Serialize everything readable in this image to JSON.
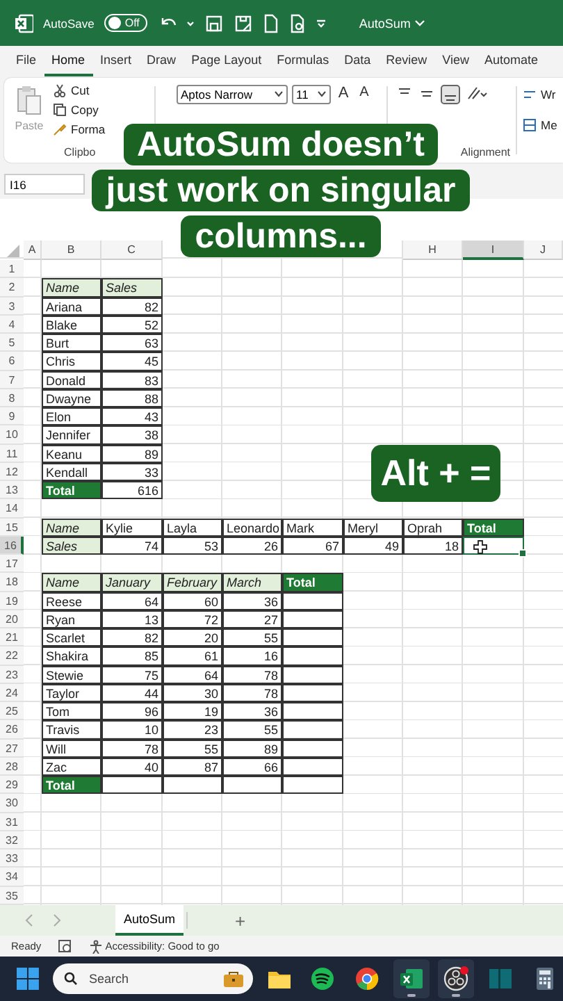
{
  "title_bar": {
    "autosave_label": "AutoSave",
    "autosave": {
      "on": false,
      "label": "Off"
    },
    "document": "AutoSum"
  },
  "menu_tabs": [
    {
      "label": "File",
      "selected": false
    },
    {
      "label": "Home",
      "selected": true
    },
    {
      "label": "Insert",
      "selected": false
    },
    {
      "label": "Draw",
      "selected": false
    },
    {
      "label": "Page Layout",
      "selected": false
    },
    {
      "label": "Formulas",
      "selected": false
    },
    {
      "label": "Data",
      "selected": false
    },
    {
      "label": "Review",
      "selected": false
    },
    {
      "label": "View",
      "selected": false
    },
    {
      "label": "Automate",
      "selected": false
    }
  ],
  "ribbon": {
    "paste": "Paste",
    "cut": "Cut",
    "copy": "Copy",
    "format_painter": "Forma",
    "clipboard_label": "Clipbo",
    "font": "Aptos Narrow",
    "font_size": "11",
    "grow_font": "A",
    "shrink_font": "A",
    "alignment_label": "Alignment",
    "wrap_text": "Wr",
    "merge": "Me"
  },
  "name_box": "I16",
  "caption": {
    "lines": [
      "AutoSum doesn’t",
      "just work on singular",
      "columns..."
    ]
  },
  "shortcut_caption": "Alt + =",
  "sheet": {
    "columns": [
      {
        "label": "A",
        "selected": false
      },
      {
        "label": "B",
        "selected": false
      },
      {
        "label": "C",
        "selected": false
      },
      {
        "label": "H",
        "selected": false
      },
      {
        "label": "I",
        "selected": true
      },
      {
        "label": "J",
        "selected": false
      }
    ],
    "rows": [
      {
        "label": "1",
        "selected": false
      },
      {
        "label": "2",
        "selected": false
      },
      {
        "label": "3",
        "selected": false
      },
      {
        "label": "4",
        "selected": false
      },
      {
        "label": "5",
        "selected": false
      },
      {
        "label": "6",
        "selected": false
      },
      {
        "label": "7",
        "selected": false
      },
      {
        "label": "8",
        "selected": false
      },
      {
        "label": "9",
        "selected": false
      },
      {
        "label": "10",
        "selected": false
      },
      {
        "label": "11",
        "selected": false
      },
      {
        "label": "12",
        "selected": false
      },
      {
        "label": "13",
        "selected": false
      },
      {
        "label": "14",
        "selected": false
      },
      {
        "label": "15",
        "selected": false
      },
      {
        "label": "16",
        "selected": true
      },
      {
        "label": "17",
        "selected": false
      },
      {
        "label": "18",
        "selected": false
      },
      {
        "label": "19",
        "selected": false
      },
      {
        "label": "20",
        "selected": false
      },
      {
        "label": "21",
        "selected": false
      },
      {
        "label": "22",
        "selected": false
      },
      {
        "label": "23",
        "selected": false
      },
      {
        "label": "24",
        "selected": false
      },
      {
        "label": "25",
        "selected": false
      },
      {
        "label": "26",
        "selected": false
      },
      {
        "label": "27",
        "selected": false
      },
      {
        "label": "28",
        "selected": false
      },
      {
        "label": "29",
        "selected": false
      },
      {
        "label": "30",
        "selected": false
      },
      {
        "label": "31",
        "selected": false
      },
      {
        "label": "32",
        "selected": false
      },
      {
        "label": "33",
        "selected": false
      },
      {
        "label": "34",
        "selected": false
      },
      {
        "label": "35",
        "selected": false
      }
    ],
    "tables": [
      {
        "rows": [
          [
            {
              "kind": "header",
              "text": "Name"
            },
            {
              "kind": "header",
              "text": "Sales"
            }
          ],
          [
            {
              "kind": "text",
              "text": "Ariana"
            },
            {
              "kind": "number",
              "text": "82"
            }
          ],
          [
            {
              "kind": "text",
              "text": "Blake"
            },
            {
              "kind": "number",
              "text": "52"
            }
          ],
          [
            {
              "kind": "text",
              "text": "Burt"
            },
            {
              "kind": "number",
              "text": "63"
            }
          ],
          [
            {
              "kind": "text",
              "text": "Chris"
            },
            {
              "kind": "number",
              "text": "45"
            }
          ],
          [
            {
              "kind": "text",
              "text": "Donald"
            },
            {
              "kind": "number",
              "text": "83"
            }
          ],
          [
            {
              "kind": "text",
              "text": "Dwayne"
            },
            {
              "kind": "number",
              "text": "88"
            }
          ],
          [
            {
              "kind": "text",
              "text": "Elon"
            },
            {
              "kind": "number",
              "text": "43"
            }
          ],
          [
            {
              "kind": "text",
              "text": "Jennifer"
            },
            {
              "kind": "number",
              "text": "38"
            }
          ],
          [
            {
              "kind": "text",
              "text": "Keanu"
            },
            {
              "kind": "number",
              "text": "89"
            }
          ],
          [
            {
              "kind": "text",
              "text": "Kendall"
            },
            {
              "kind": "number",
              "text": "33"
            }
          ],
          [
            {
              "kind": "total",
              "text": "Total"
            },
            {
              "kind": "number",
              "text": "616"
            }
          ]
        ]
      },
      {
        "rows": [
          [
            {
              "kind": "header",
              "text": "Name"
            },
            {
              "kind": "text",
              "text": "Kylie"
            },
            {
              "kind": "text",
              "text": "Layla"
            },
            {
              "kind": "text",
              "text": "Leonardo"
            },
            {
              "kind": "text",
              "text": "Mark"
            },
            {
              "kind": "text",
              "text": "Meryl"
            },
            {
              "kind": "text",
              "text": "Oprah"
            },
            {
              "kind": "total",
              "text": "Total"
            }
          ],
          [
            {
              "kind": "header",
              "text": "Sales"
            },
            {
              "kind": "number",
              "text": "74"
            },
            {
              "kind": "number",
              "text": "53"
            },
            {
              "kind": "number",
              "text": "26"
            },
            {
              "kind": "number",
              "text": "67"
            },
            {
              "kind": "number",
              "text": "49"
            },
            {
              "kind": "number",
              "text": "18"
            },
            {
              "kind": "empty",
              "selected": true
            }
          ]
        ]
      },
      {
        "rows": [
          [
            {
              "kind": "header",
              "text": "Name"
            },
            {
              "kind": "header",
              "text": "January"
            },
            {
              "kind": "header",
              "text": "February"
            },
            {
              "kind": "header",
              "text": "March"
            },
            {
              "kind": "total",
              "text": "Total"
            }
          ],
          [
            {
              "kind": "text",
              "text": "Reese"
            },
            {
              "kind": "number",
              "text": "64"
            },
            {
              "kind": "number",
              "text": "60"
            },
            {
              "kind": "number",
              "text": "36"
            },
            {
              "kind": "empty"
            }
          ],
          [
            {
              "kind": "text",
              "text": "Ryan"
            },
            {
              "kind": "number",
              "text": "13"
            },
            {
              "kind": "number",
              "text": "72"
            },
            {
              "kind": "number",
              "text": "27"
            },
            {
              "kind": "empty"
            }
          ],
          [
            {
              "kind": "text",
              "text": "Scarlet"
            },
            {
              "kind": "number",
              "text": "82"
            },
            {
              "kind": "number",
              "text": "20"
            },
            {
              "kind": "number",
              "text": "55"
            },
            {
              "kind": "empty"
            }
          ],
          [
            {
              "kind": "text",
              "text": "Shakira"
            },
            {
              "kind": "number",
              "text": "85"
            },
            {
              "kind": "number",
              "text": "61"
            },
            {
              "kind": "number",
              "text": "16"
            },
            {
              "kind": "empty"
            }
          ],
          [
            {
              "kind": "text",
              "text": "Stewie"
            },
            {
              "kind": "number",
              "text": "75"
            },
            {
              "kind": "number",
              "text": "64"
            },
            {
              "kind": "number",
              "text": "78"
            },
            {
              "kind": "empty"
            }
          ],
          [
            {
              "kind": "text",
              "text": "Taylor"
            },
            {
              "kind": "number",
              "text": "44"
            },
            {
              "kind": "number",
              "text": "30"
            },
            {
              "kind": "number",
              "text": "78"
            },
            {
              "kind": "empty"
            }
          ],
          [
            {
              "kind": "text",
              "text": "Tom"
            },
            {
              "kind": "number",
              "text": "96"
            },
            {
              "kind": "number",
              "text": "19"
            },
            {
              "kind": "number",
              "text": "36"
            },
            {
              "kind": "empty"
            }
          ],
          [
            {
              "kind": "text",
              "text": "Travis"
            },
            {
              "kind": "number",
              "text": "10"
            },
            {
              "kind": "number",
              "text": "23"
            },
            {
              "kind": "number",
              "text": "55"
            },
            {
              "kind": "empty"
            }
          ],
          [
            {
              "kind": "text",
              "text": "Will"
            },
            {
              "kind": "number",
              "text": "78"
            },
            {
              "kind": "number",
              "text": "55"
            },
            {
              "kind": "number",
              "text": "89"
            },
            {
              "kind": "empty"
            }
          ],
          [
            {
              "kind": "text",
              "text": "Zac"
            },
            {
              "kind": "number",
              "text": "40"
            },
            {
              "kind": "number",
              "text": "87"
            },
            {
              "kind": "number",
              "text": "66"
            },
            {
              "kind": "empty"
            }
          ],
          [
            {
              "kind": "total",
              "text": "Total"
            },
            {
              "kind": "empty"
            },
            {
              "kind": "empty"
            },
            {
              "kind": "empty"
            },
            {
              "kind": "empty"
            }
          ]
        ]
      }
    ]
  },
  "sheet_tabs": [
    {
      "label": "AutoSum",
      "selected": true
    }
  ],
  "add_sheet": "+",
  "status_bar": {
    "mode": "Ready",
    "accessibility": "Accessibility: Good to go"
  },
  "taskbar": {
    "search": {
      "placeholder": "Search"
    },
    "apps": [
      {
        "kind": "folder",
        "running": false
      },
      {
        "kind": "music",
        "running": false
      },
      {
        "kind": "browser",
        "running": false
      },
      {
        "kind": "excel",
        "running": true
      },
      {
        "kind": "recorder",
        "running": true
      },
      {
        "kind": "book",
        "running": false
      },
      {
        "kind": "calculator",
        "running": false
      }
    ]
  }
}
